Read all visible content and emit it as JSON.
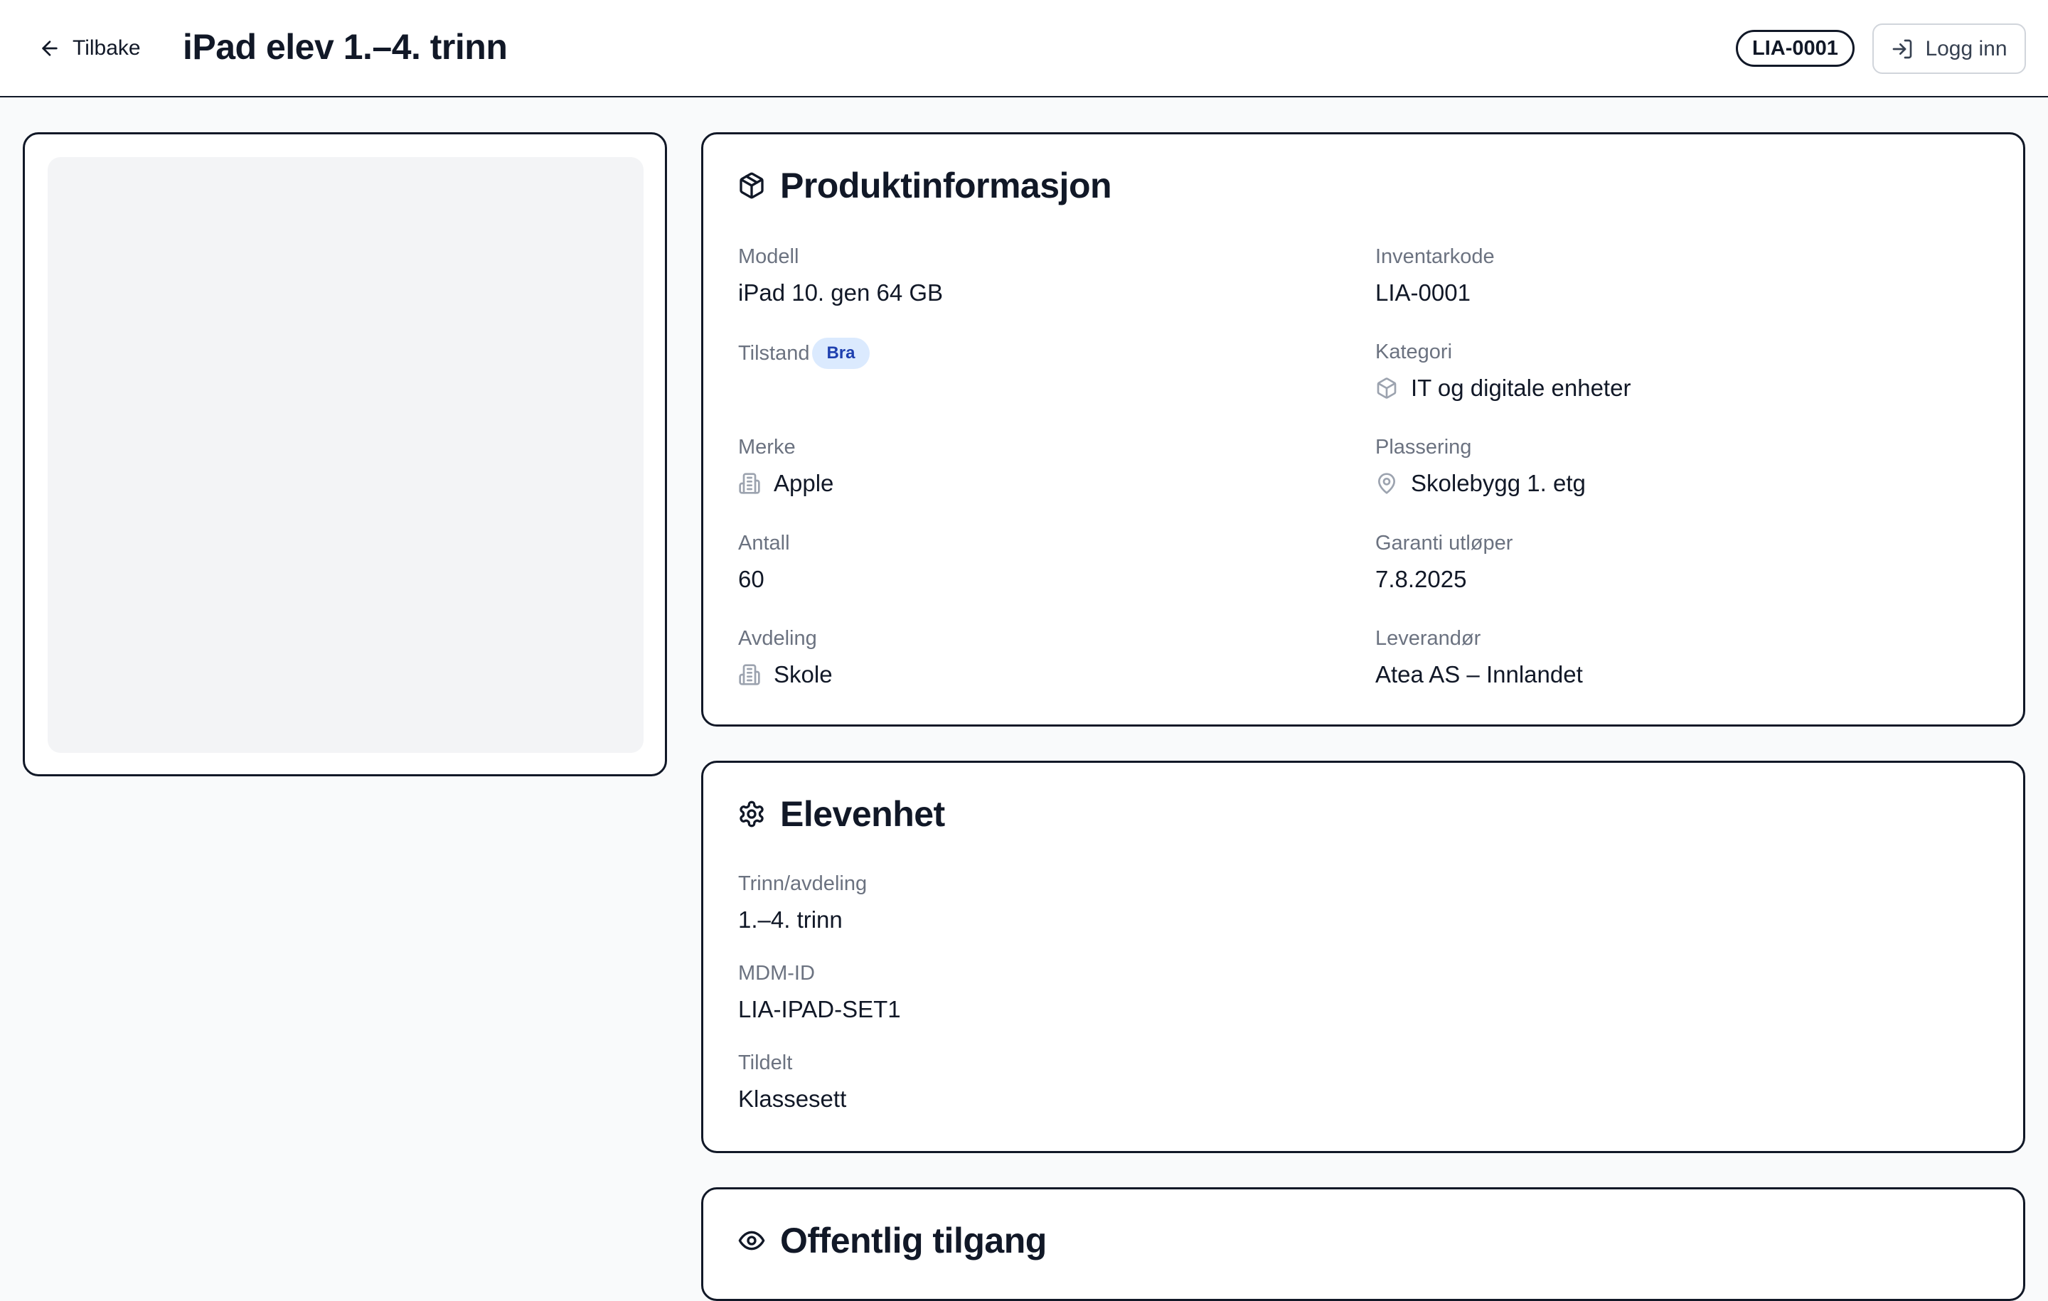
{
  "header": {
    "back_label": "Tilbake",
    "title": "iPad elev 1.–4. trinn",
    "code_badge": "LIA-0001",
    "login_label": "Logg inn"
  },
  "product": {
    "title": "Produktinformasjon",
    "model": {
      "label": "Modell",
      "value": "iPad 10. gen 64 GB"
    },
    "inventory_code": {
      "label": "Inventarkode",
      "value": "LIA-0001"
    },
    "condition": {
      "label": "Tilstand",
      "badge": "Bra"
    },
    "category": {
      "label": "Kategori",
      "value": "IT og digitale enheter",
      "icon": "box-icon"
    },
    "brand": {
      "label": "Merke",
      "value": "Apple",
      "icon": "building-icon"
    },
    "location": {
      "label": "Plassering",
      "value": "Skolebygg 1. etg",
      "icon": "map-pin-icon"
    },
    "quantity": {
      "label": "Antall",
      "value": "60"
    },
    "warranty": {
      "label": "Garanti utløper",
      "value": "7.8.2025"
    },
    "department": {
      "label": "Avdeling",
      "value": "Skole",
      "icon": "building-icon"
    },
    "supplier": {
      "label": "Leverandør",
      "value": "Atea AS – Innlandet"
    }
  },
  "student_device": {
    "title": "Elevenhet",
    "grade": {
      "label": "Trinn/avdeling",
      "value": "1.–4. trinn"
    },
    "mdm_id": {
      "label": "MDM-ID",
      "value": "LIA-IPAD-SET1"
    },
    "assigned": {
      "label": "Tildelt",
      "value": "Klassesett"
    }
  },
  "public_access": {
    "title": "Offentlig tilgang"
  },
  "colors": {
    "border": "#111827",
    "muted_text": "#6b7280",
    "badge_bg": "#dbeafe",
    "badge_text": "#1e40af",
    "placeholder": "#f3f4f6"
  }
}
